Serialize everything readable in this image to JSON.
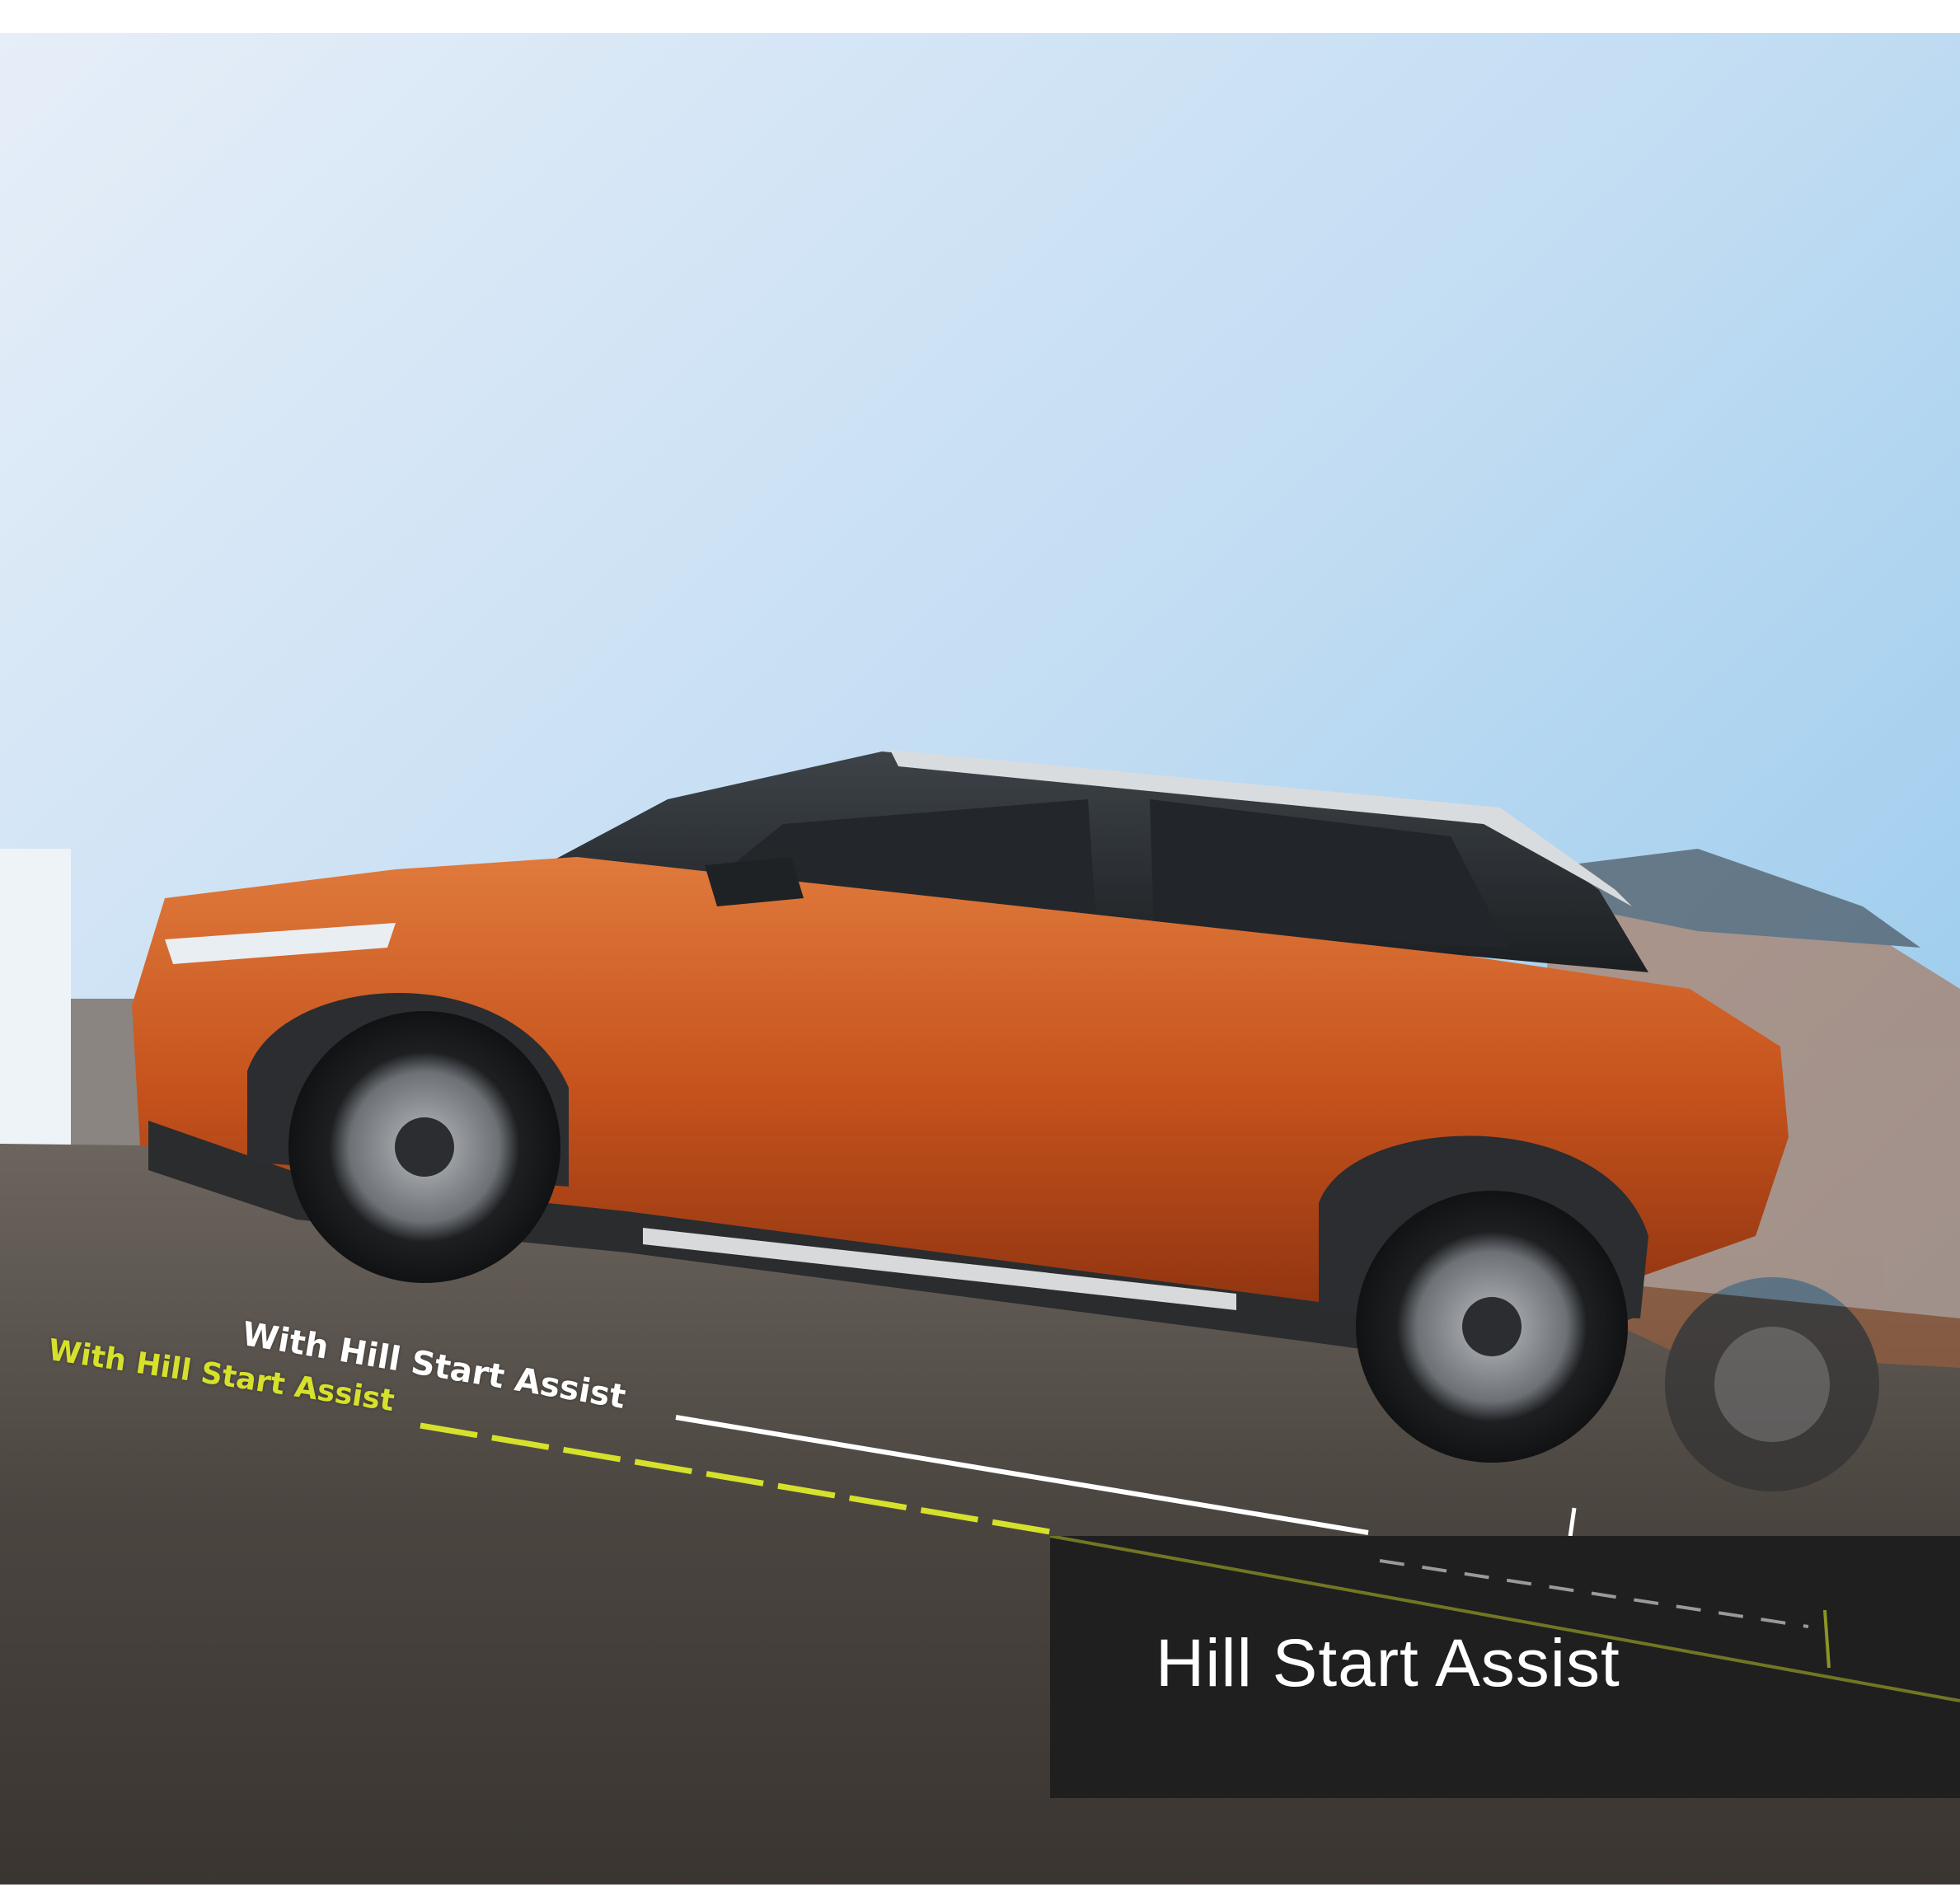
{
  "labels": {
    "with_assist_white": "With Hill Start Assist",
    "with_assist_yellow": "With Hill Start Assist"
  },
  "caption": {
    "title": "Hill Start Assist"
  },
  "colors": {
    "sky_top": "#d9e8f6",
    "sky_bottom": "#8ec7ec",
    "road": "#4a4540",
    "car_body": "#c8541c",
    "car_roof": "#2a2d30",
    "accent_yellow": "#d6e12b",
    "caption_bg": "#1f1f1f"
  },
  "icons": {
    "vehicle": "orange-suv-illustration",
    "ghost_vehicle": "rolling-back-suv-illustration"
  }
}
